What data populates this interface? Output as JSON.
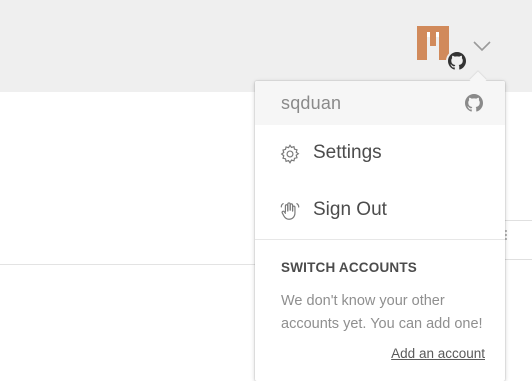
{
  "account_menu": {
    "username": "sqduan",
    "provider_icon": "github-icon",
    "items": [
      {
        "label": "Settings",
        "icon": "gear-icon"
      },
      {
        "label": "Sign Out",
        "icon": "waving-hand-icon"
      }
    ],
    "switch_accounts": {
      "title": "SWITCH ACCOUNTS",
      "description": "We don't know your other accounts yet. You can add one!",
      "add_link": "Add an account"
    }
  },
  "header": {
    "avatar_icon": "identicon-avatar",
    "avatar_color": "#d18a5b",
    "dropdown_icon": "chevron-down-icon"
  }
}
